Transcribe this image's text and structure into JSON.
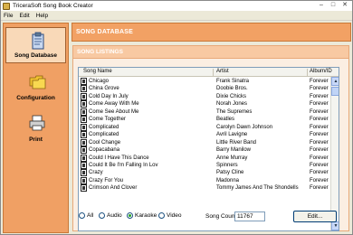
{
  "window": {
    "title": "TriceraSoft Song Book Creator",
    "minimize": "–",
    "maximize": "□",
    "close": "✕"
  },
  "menu": [
    "File",
    "Edit",
    "Help"
  ],
  "sidebar": {
    "items": [
      {
        "label": "Song Database",
        "icon": "clipboard-icon",
        "active": true
      },
      {
        "label": "Configuration",
        "icon": "folders-icon",
        "active": false
      },
      {
        "label": "Print",
        "icon": "printer-icon",
        "active": false
      }
    ]
  },
  "header": {
    "title": "SONG DATABASE"
  },
  "panel": {
    "title": "SONG LISTINGS"
  },
  "list": {
    "columns": [
      "Song Name",
      "Artist",
      "Album/ID"
    ],
    "rows": [
      [
        "Chicago",
        "Frank Sinatra",
        "Forever Hi"
      ],
      [
        "China Grove",
        "Doobie Bros.",
        "Forever Hi"
      ],
      [
        "Cold Day In July",
        "Dixie Chicks",
        "Forever Hi"
      ],
      [
        "Come Away With Me",
        "Norah Jones",
        "Forever Hi"
      ],
      [
        "Come See About Me",
        "The Supremes",
        "Forever Hi"
      ],
      [
        "Come Together",
        "Beatles",
        "Forever Hi"
      ],
      [
        "Complicated",
        "Carolyn Dawn Johnson",
        "Forever Hi"
      ],
      [
        "Complicated",
        "Avril Lavigne",
        "Forever Hi"
      ],
      [
        "Cool Change",
        "Little River Band",
        "Forever Hi"
      ],
      [
        "Copacabana",
        "Barry Manilow",
        "Forever Hi"
      ],
      [
        "Could I Have This Dance",
        "Anne Murray",
        "Forever Hi"
      ],
      [
        "Could It Be I'm Falling In Lov",
        "Spinners",
        "Forever Hi"
      ],
      [
        "Crazy",
        "Patsy Cline",
        "Forever Hi"
      ],
      [
        "Crazy For You",
        "Madonna",
        "Forever Hi"
      ],
      [
        "Crimson And Clover",
        "Tommy James And The Shondells",
        "Forever Hi"
      ]
    ]
  },
  "filters": {
    "options": [
      {
        "label": "All",
        "selected": false
      },
      {
        "label": "Audio",
        "selected": false
      },
      {
        "label": "Karaoke",
        "selected": true
      },
      {
        "label": "Video",
        "selected": false
      }
    ]
  },
  "song_count": {
    "label": "Song Count:",
    "value": "11767"
  },
  "edit_button": {
    "label": "Edit..."
  },
  "colors": {
    "accent": "#f2a164",
    "sidebar": "#f0a064",
    "panel_head": "#f8c9a2"
  }
}
